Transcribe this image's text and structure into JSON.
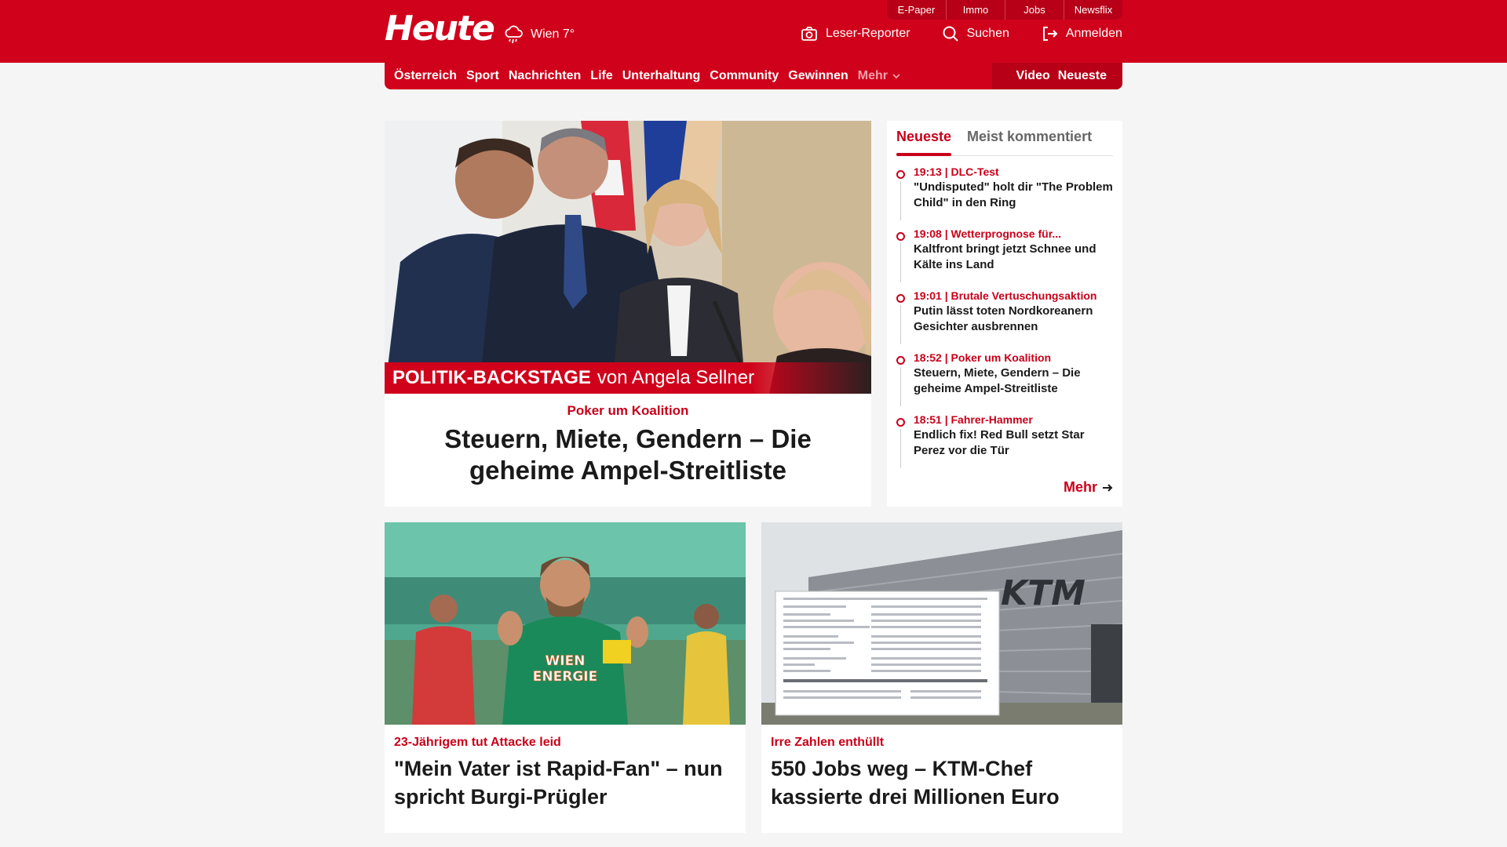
{
  "header": {
    "logo": "Heute",
    "weather": "Wien 7°",
    "services": [
      "E-Paper",
      "Immo",
      "Jobs",
      "Newsflix"
    ],
    "actions": {
      "reporter": "Leser-Reporter",
      "search": "Suchen",
      "login": "Anmelden"
    }
  },
  "nav": {
    "items": [
      "Österreich",
      "Sport",
      "Nachrichten",
      "Life",
      "Unterhaltung",
      "Community",
      "Gewinnen"
    ],
    "more": "Mehr",
    "right": [
      "Video",
      "Neueste"
    ]
  },
  "hero": {
    "banner_bold": "POLITIK-BACKSTAGE",
    "banner_rest": "von Angela Sellner",
    "kicker": "Poker um Koalition",
    "title": "Steuern, Miete, Gendern – Die geheime Ampel-Streitliste"
  },
  "sidebar": {
    "tabs": [
      "Neueste",
      "Meist kommentiert"
    ],
    "items": [
      {
        "meta": "19:13 | DLC-Test",
        "title": "\"Undisputed\" holt dir \"The Problem Child\" in den Ring"
      },
      {
        "meta": "19:08 | Wetterprognose für...",
        "title": "Kaltfront bringt jetzt Schnee und Kälte ins Land"
      },
      {
        "meta": "19:01 | Brutale Vertuschungsaktion",
        "title": "Putin lässt toten Nordkoreanern Gesichter ausbrennen"
      },
      {
        "meta": "18:52 | Poker um Koalition",
        "title": "Steuern, Miete, Gendern – Die geheime Ampel-Streitliste"
      },
      {
        "meta": "18:51 | Fahrer-Hammer",
        "title": "Endlich fix! Red Bull setzt Star Perez vor die Tür"
      }
    ],
    "more": "Mehr"
  },
  "cards": [
    {
      "kicker": "23-Jährigem tut Attacke leid",
      "title": "\"Mein Vater ist Rapid-Fan\" – nun spricht Burgi-Prügler",
      "shirt_text_1": "WIEN",
      "shirt_text_2": "ENERGIE"
    },
    {
      "kicker": "Irre Zahlen enthüllt",
      "title": "550 Jobs weg – KTM-Chef kassierte drei Millionen Euro",
      "building_logo": "KTM"
    }
  ],
  "colors": {
    "brand_red": "#d0021b",
    "dark_red": "#b70017",
    "kicker_red": "#c8001a"
  }
}
